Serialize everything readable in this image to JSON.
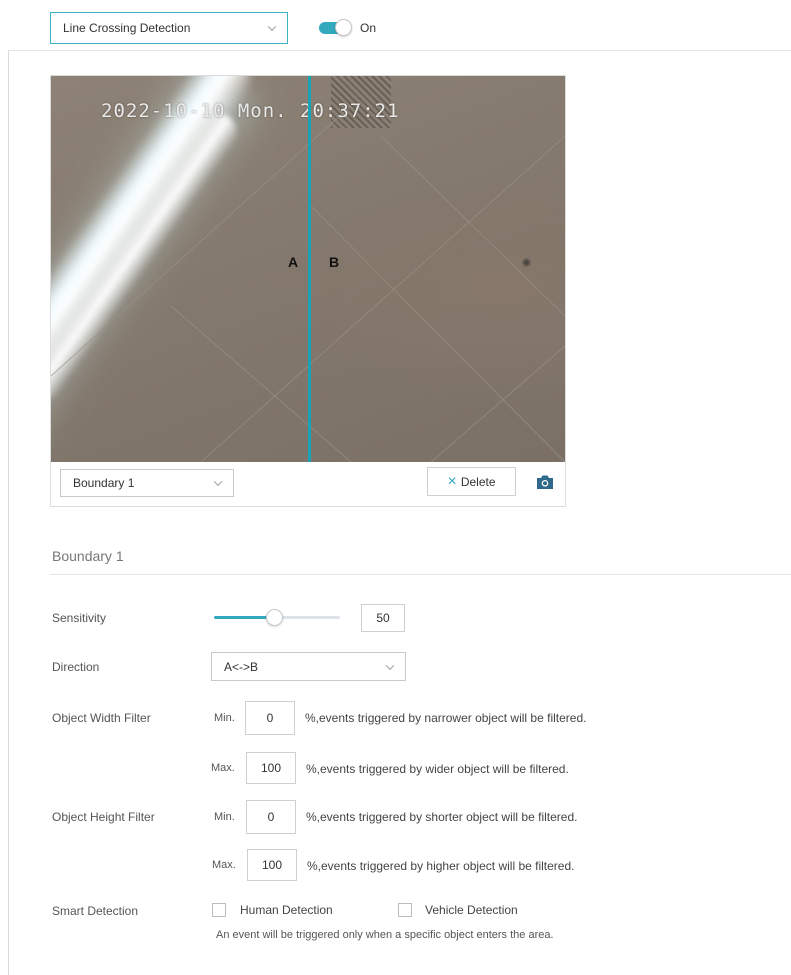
{
  "header": {
    "detection_type": "Line Crossing Detection",
    "toggle_state": "On"
  },
  "preview": {
    "timestamp": "2022-10-10 Mon. 20:37:21",
    "point_a": "A",
    "point_b": "B",
    "boundary_selected": "Boundary 1",
    "delete_label": "Delete"
  },
  "section": {
    "title": "Boundary 1"
  },
  "form": {
    "sensitivity": {
      "label": "Sensitivity",
      "value": "50"
    },
    "direction": {
      "label": "Direction",
      "value": "A<->B"
    },
    "width_filter": {
      "label": "Object Width Filter",
      "min_label": "Min.",
      "min_value": "0",
      "min_desc": "%,events triggered by narrower object will be filtered.",
      "max_label": "Max.",
      "max_value": "100",
      "max_desc": "%,events triggered by wider object will be filtered."
    },
    "height_filter": {
      "label": "Object Height Filter",
      "min_label": "Min.",
      "min_value": "0",
      "min_desc": "%,events triggered by shorter object will be filtered.",
      "max_label": "Max.",
      "max_value": "100",
      "max_desc": "%,events triggered by higher object will be filtered."
    },
    "smart_detection": {
      "label": "Smart Detection",
      "human": "Human Detection",
      "vehicle": "Vehicle Detection",
      "hint": "An event will be triggered only when a specific object enters the area."
    }
  },
  "colors": {
    "accent": "#33a9be"
  }
}
